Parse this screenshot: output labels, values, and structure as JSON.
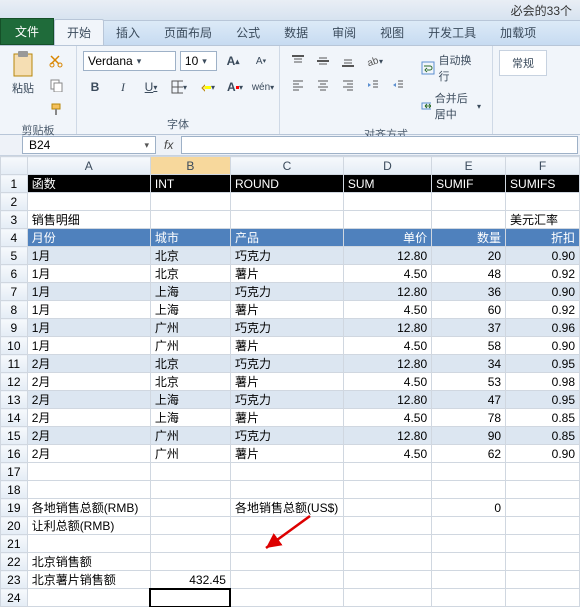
{
  "title_right": "必会的33个",
  "tabs": {
    "file": "文件",
    "items": [
      "开始",
      "插入",
      "页面布局",
      "公式",
      "数据",
      "审阅",
      "视图",
      "开发工具",
      "加载项"
    ],
    "active": 0
  },
  "ribbon": {
    "clipboard_label": "剪贴板",
    "paste": "粘贴",
    "font_name": "Verdana",
    "font_size": "10",
    "font_label": "字体",
    "align_label": "对齐方式",
    "wrap_text": "自动换行",
    "merge_center": "合并后居中",
    "normal": "常规"
  },
  "namebox": "B24",
  "grid": {
    "cols": [
      "A",
      "B",
      "C",
      "D",
      "E",
      "F"
    ],
    "row1": [
      "函数",
      "INT",
      "ROUND",
      "SUM",
      "SUMIF",
      "SUMIFS"
    ],
    "row3": {
      "A": "销售明细",
      "F": "美元汇率"
    },
    "row4": [
      "月份",
      "城市",
      "产品",
      "单价",
      "数量",
      "折扣"
    ],
    "data": [
      [
        "1月",
        "北京",
        "巧克力",
        "12.80",
        "20",
        "0.90"
      ],
      [
        "1月",
        "北京",
        "薯片",
        "4.50",
        "48",
        "0.92"
      ],
      [
        "1月",
        "上海",
        "巧克力",
        "12.80",
        "36",
        "0.90"
      ],
      [
        "1月",
        "上海",
        "薯片",
        "4.50",
        "60",
        "0.92"
      ],
      [
        "1月",
        "广州",
        "巧克力",
        "12.80",
        "37",
        "0.96"
      ],
      [
        "1月",
        "广州",
        "薯片",
        "4.50",
        "58",
        "0.90"
      ],
      [
        "2月",
        "北京",
        "巧克力",
        "12.80",
        "34",
        "0.95"
      ],
      [
        "2月",
        "北京",
        "薯片",
        "4.50",
        "53",
        "0.98"
      ],
      [
        "2月",
        "上海",
        "巧克力",
        "12.80",
        "47",
        "0.95"
      ],
      [
        "2月",
        "上海",
        "薯片",
        "4.50",
        "78",
        "0.85"
      ],
      [
        "2月",
        "广州",
        "巧克力",
        "12.80",
        "90",
        "0.85"
      ],
      [
        "2月",
        "广州",
        "薯片",
        "4.50",
        "62",
        "0.90"
      ]
    ],
    "row19": {
      "A": "各地销售总额(RMB)",
      "C": "各地销售总额(US$)",
      "E": "0"
    },
    "row20": {
      "A": "让利总额(RMB)"
    },
    "row22": {
      "A": "北京销售额"
    },
    "row23": {
      "A": "北京薯片销售额",
      "B": "432.45"
    }
  },
  "chart_data": {
    "type": "table",
    "title": "销售明细",
    "columns": [
      "月份",
      "城市",
      "产品",
      "单价",
      "数量",
      "折扣"
    ],
    "rows": [
      [
        "1月",
        "北京",
        "巧克力",
        12.8,
        20,
        0.9
      ],
      [
        "1月",
        "北京",
        "薯片",
        4.5,
        48,
        0.92
      ],
      [
        "1月",
        "上海",
        "巧克力",
        12.8,
        36,
        0.9
      ],
      [
        "1月",
        "上海",
        "薯片",
        4.5,
        60,
        0.92
      ],
      [
        "1月",
        "广州",
        "巧克力",
        12.8,
        37,
        0.96
      ],
      [
        "1月",
        "广州",
        "薯片",
        4.5,
        58,
        0.9
      ],
      [
        "2月",
        "北京",
        "巧克力",
        12.8,
        34,
        0.95
      ],
      [
        "2月",
        "北京",
        "薯片",
        4.5,
        53,
        0.98
      ],
      [
        "2月",
        "上海",
        "巧克力",
        12.8,
        47,
        0.95
      ],
      [
        "2月",
        "上海",
        "薯片",
        4.5,
        78,
        0.85
      ],
      [
        "2月",
        "广州",
        "巧克力",
        12.8,
        90,
        0.85
      ],
      [
        "2月",
        "广州",
        "薯片",
        4.5,
        62,
        0.9
      ]
    ],
    "summary": {
      "各地销售总额(US$)": 0,
      "北京薯片销售额": 432.45
    }
  }
}
